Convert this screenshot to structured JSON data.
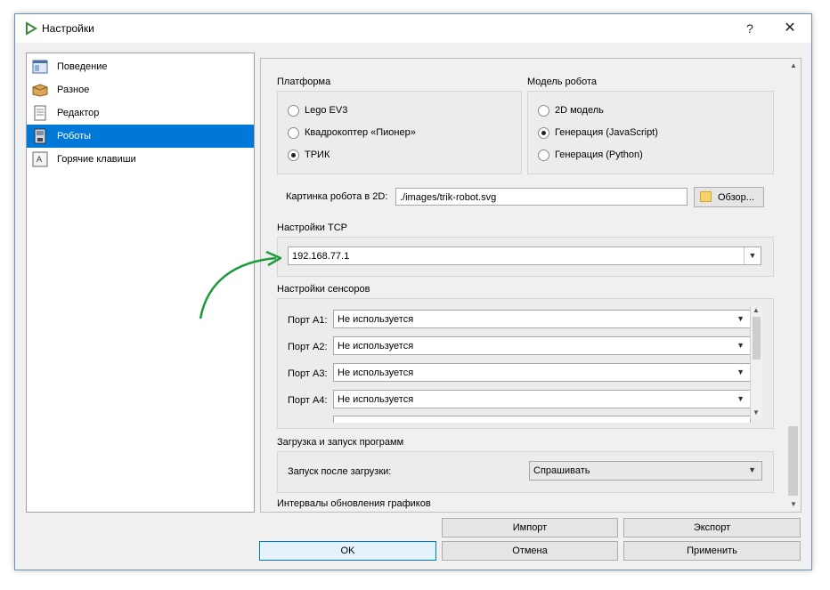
{
  "window": {
    "title": "Настройки",
    "help": "?",
    "close": "✕"
  },
  "categories": [
    {
      "label": "Поведение",
      "icon": "behavior-icon",
      "selected": false
    },
    {
      "label": "Разное",
      "icon": "misc-box-icon",
      "selected": false
    },
    {
      "label": "Редактор",
      "icon": "editor-document-icon",
      "selected": false
    },
    {
      "label": "Роботы",
      "icon": "robot-brick-icon",
      "selected": true
    },
    {
      "label": "Горячие клавиши",
      "icon": "keyboard-key-icon",
      "selected": false
    }
  ],
  "platform": {
    "title": "Платформа",
    "options": [
      {
        "label": "Lego EV3",
        "checked": false
      },
      {
        "label": "Квадрокоптер «Пионер»",
        "checked": false
      },
      {
        "label": "ТРИК",
        "checked": true
      }
    ]
  },
  "robot_model": {
    "title": "Модель робота",
    "options": [
      {
        "label": "2D модель",
        "checked": false
      },
      {
        "label": "Генерация (JavaScript)",
        "checked": true
      },
      {
        "label": "Генерация (Python)",
        "checked": false
      }
    ]
  },
  "robot_image": {
    "label": "Картинка робота в 2D:",
    "value": "./images/trik-robot.svg",
    "browse": "Обзор..."
  },
  "tcp": {
    "title": "Настройки TCP",
    "value": "192.168.77.1"
  },
  "sensors": {
    "title": "Настройки сенсоров",
    "ports": [
      {
        "label": "Порт A1:",
        "value": "Не используется"
      },
      {
        "label": "Порт A2:",
        "value": "Не используется"
      },
      {
        "label": "Порт A3:",
        "value": "Не используется"
      },
      {
        "label": "Порт A4:",
        "value": "Не используется"
      }
    ]
  },
  "upload": {
    "title": "Загрузка и запуск программ",
    "label": "Запуск после загрузки:",
    "value": "Спрашивать"
  },
  "graphs": {
    "title": "Интервалы обновления графиков"
  },
  "buttons": {
    "import": "Импорт",
    "export": "Экспорт",
    "ok": "OK",
    "cancel": "Отмена",
    "apply": "Применить"
  },
  "colors": {
    "selection": "#0078d7",
    "arrow": "#1e9a3c",
    "window_bg": "#f0f0f0"
  }
}
